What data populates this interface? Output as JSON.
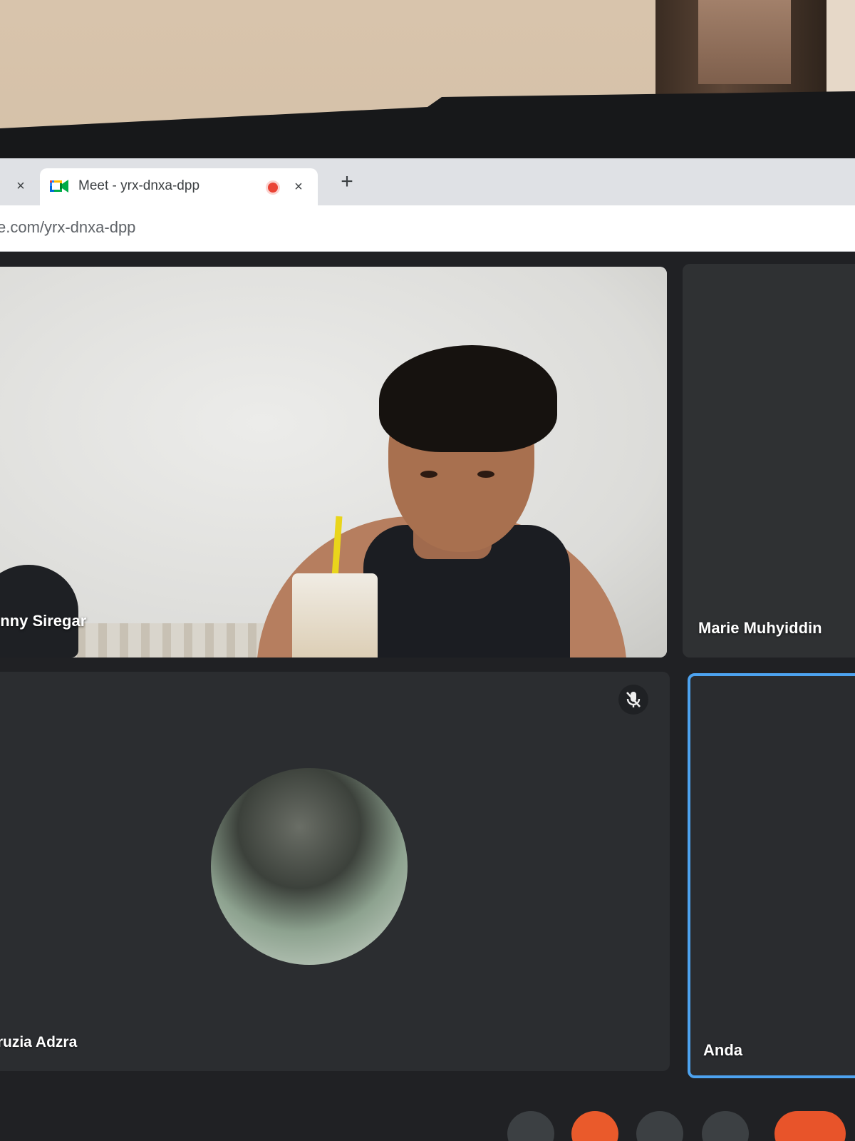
{
  "browser": {
    "tab_prev_close": "×",
    "active_tab": {
      "title": "Meet - yrx-dnxa-dpp",
      "close": "×"
    },
    "new_tab": "+",
    "url": "e.com/yrx-dnxa-dpp"
  },
  "meeting": {
    "participants": [
      {
        "name": "enny Siregar"
      },
      {
        "name": "Marie Muhyiddin"
      },
      {
        "name": "iruzia Adzra",
        "muted": true
      },
      {
        "name": "Anda"
      }
    ]
  },
  "colors": {
    "accent_blue": "#4da3f0",
    "record_red": "#ea4335",
    "end_call": "#e8542a",
    "tile_bg": "#2b2d30"
  },
  "icons": [
    "close-icon",
    "google-meet-icon",
    "recording-icon",
    "plus-icon",
    "mic-off-icon",
    "mic-icon",
    "camera-icon",
    "present-icon",
    "more-icon",
    "end-call-icon"
  ]
}
